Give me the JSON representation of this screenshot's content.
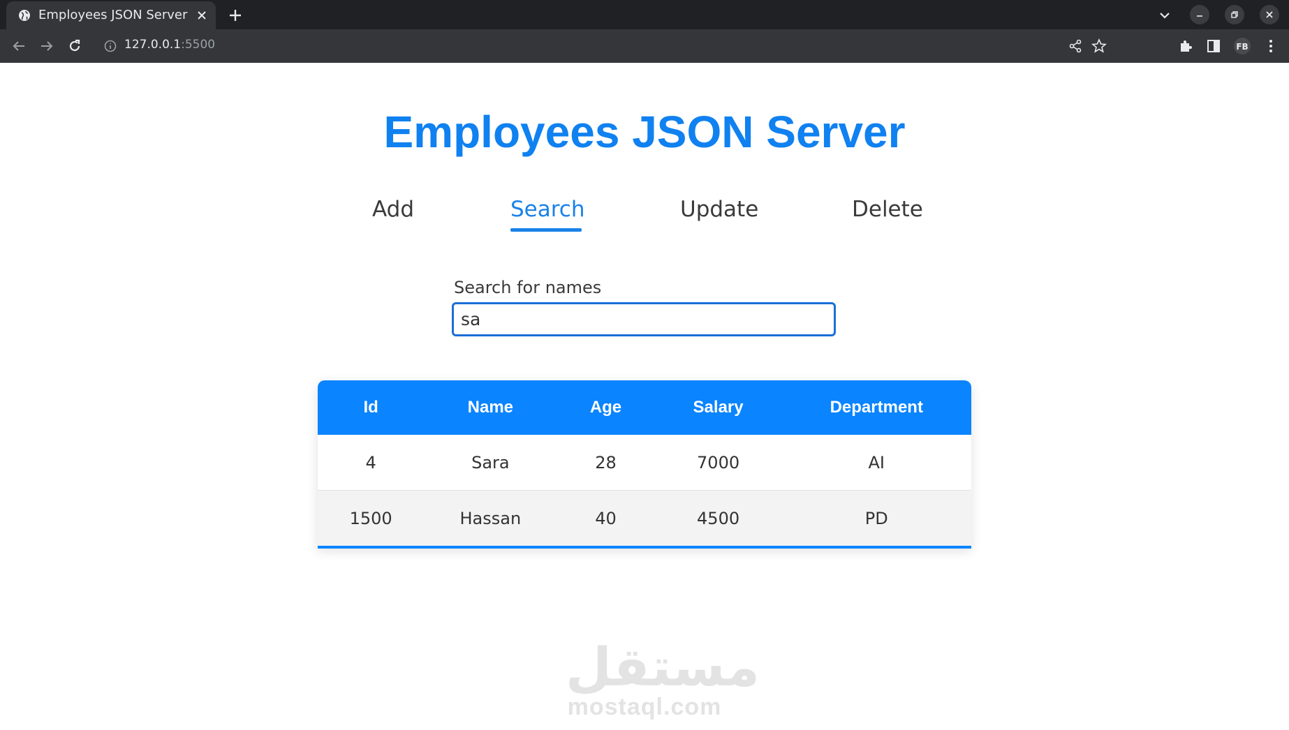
{
  "browser": {
    "tab_title": "Employees JSON Server",
    "url_host": "127.0.0.1",
    "url_port": ":5500",
    "icons": [
      "globe-icon",
      "close-icon",
      "plus-icon",
      "chevron-down-icon",
      "minimize-icon",
      "restore-icon",
      "back-icon",
      "forward-icon",
      "reload-icon",
      "info-icon",
      "share-icon",
      "star-icon",
      "puzzle-icon",
      "side-panel-icon",
      "profile-icon",
      "kebab-menu-icon"
    ]
  },
  "page": {
    "title": "Employees JSON Server",
    "nav": [
      {
        "label": "Add",
        "active": false
      },
      {
        "label": "Search",
        "active": true
      },
      {
        "label": "Update",
        "active": false
      },
      {
        "label": "Delete",
        "active": false
      }
    ],
    "search": {
      "label": "Search for names",
      "value": "sa"
    },
    "table": {
      "headers": [
        "Id",
        "Name",
        "Age",
        "Salary",
        "Department"
      ],
      "rows": [
        [
          "4",
          "Sara",
          "28",
          "7000",
          "AI"
        ],
        [
          "1500",
          "Hassan",
          "40",
          "4500",
          "PD"
        ]
      ]
    },
    "colors": {
      "accent": "#1a82e8",
      "title": "#1081f0",
      "table_header": "#0a84ff"
    }
  },
  "watermark": {
    "arabic": "مستقل",
    "latin": "mostaql.com"
  }
}
